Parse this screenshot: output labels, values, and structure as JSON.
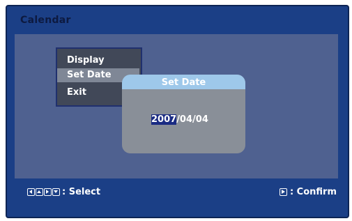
{
  "title": "Calendar",
  "menu": {
    "items": [
      {
        "label": "Display"
      },
      {
        "label": "Set Date"
      },
      {
        "label": "Exit"
      }
    ],
    "selected_index": 1
  },
  "dialog": {
    "title": "Set Date",
    "year": "2007",
    "rest": "/04/04"
  },
  "footer": {
    "left_icons": [
      "left-arrow-icon",
      "up-arrow-icon",
      "right-arrow-icon",
      "down-arrow-icon"
    ],
    "left_text": ": Select",
    "right_icon": "play-icon",
    "right_text": ": Confirm"
  },
  "colors": {
    "frame": "#1b3f86",
    "content": "#4f6190",
    "menu_bg": "#414858",
    "menu_selected": "#7f8796",
    "dialog_title": "#9ec8ea",
    "dialog_bg": "#898f98",
    "date_highlight": "#1a2b83"
  }
}
